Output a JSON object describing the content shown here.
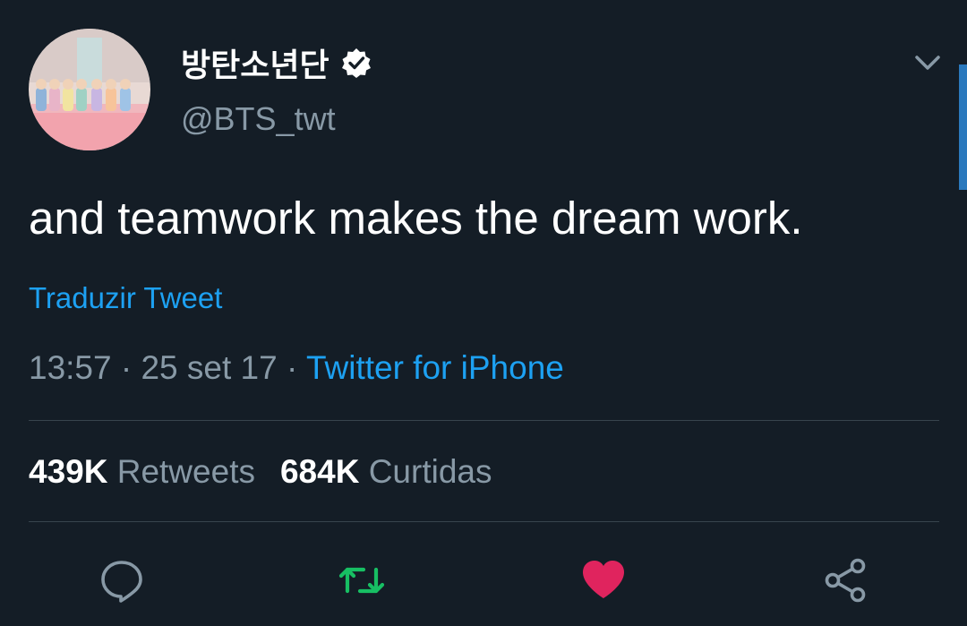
{
  "user": {
    "display_name": "방탄소년단",
    "handle": "@BTS_twt",
    "verified": true
  },
  "tweet": {
    "text": "and teamwork makes the dream work.",
    "translate_label": "Traduzir Tweet",
    "time": "13:57",
    "date": "25 set 17",
    "separator": " · ",
    "source": "Twitter for iPhone"
  },
  "stats": {
    "retweets_count": "439K",
    "retweets_label": "Retweets",
    "likes_count": "684K",
    "likes_label": "Curtidas"
  },
  "icons": {
    "reply": "reply-icon",
    "retweet": "retweet-icon",
    "like": "heart-icon",
    "share": "share-icon",
    "caret": "chevron-down-icon",
    "verified": "verified-badge-icon"
  },
  "colors": {
    "background": "#141d26",
    "link": "#1da1f2",
    "muted": "#8899a6",
    "retweet_active": "#17bf63",
    "like_active": "#e0245e"
  }
}
